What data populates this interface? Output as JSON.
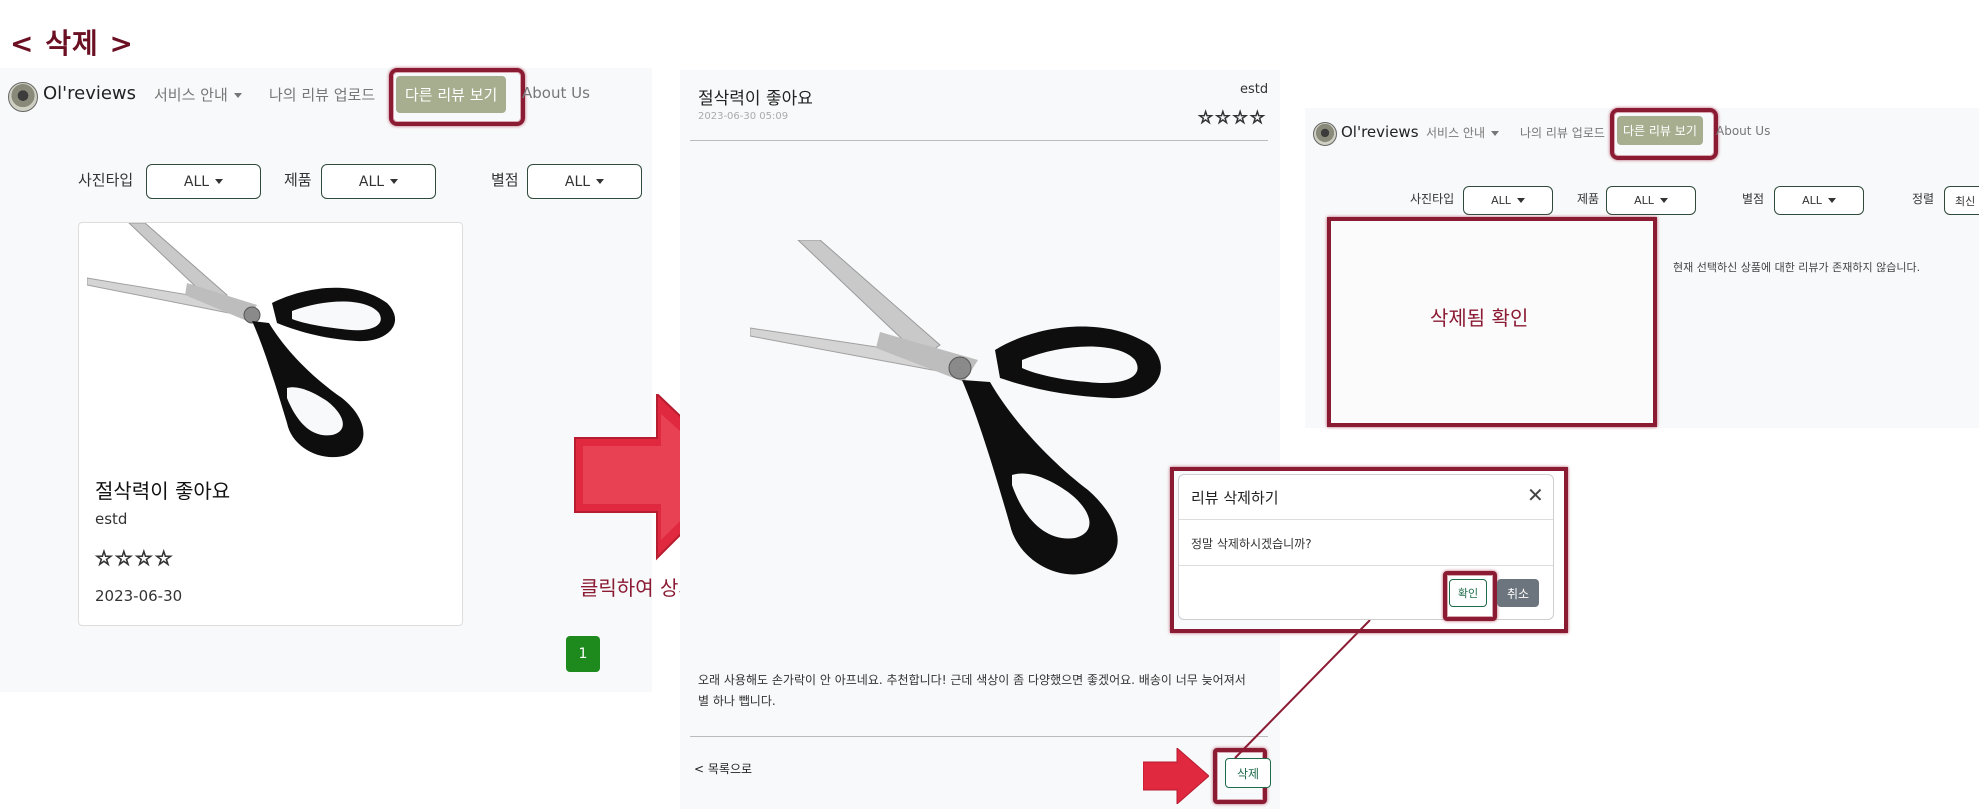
{
  "page": {
    "title": "< 삭제 >"
  },
  "navbar": {
    "brand": "Ol'reviews",
    "service_info": "서비스 안내",
    "my_review_upload": "나의 리뷰 업로드",
    "other_reviews": "다른 리뷰 보기",
    "about_us": "About Us"
  },
  "filters": {
    "photo_type_label": "사진타입",
    "product_label": "제품",
    "rating_label": "별점",
    "sort_label": "정렬",
    "all_value": "ALL",
    "sort_value_partial": "최신"
  },
  "list_panel": {
    "card": {
      "title": "절삭력이 좋아요",
      "author": "estd",
      "stars": "☆☆☆☆",
      "rating": 4,
      "date": "2023-06-30"
    },
    "pagination": {
      "current_page": "1"
    }
  },
  "arrow_annotation": {
    "text": "클릭하여 상세보기"
  },
  "detail_panel": {
    "title": "절삭력이 좋아요",
    "author": "estd",
    "datetime": "2023-06-30 05:09",
    "stars": "☆☆☆☆",
    "rating": 4,
    "body": "오래 사용해도 손가락이 안 아프네요. 추천합니다! 근데 색상이 좀 다양했으면 좋겠어요. 배송이 너무 늦어져서 별 하나 뺍니다.",
    "back_link": "< 목록으로",
    "delete_button": "삭제"
  },
  "modal": {
    "title": "리뷰 삭제하기",
    "message": "정말 삭제하시겠습니까?",
    "confirm_button": "확인",
    "cancel_button": "취소"
  },
  "result_panel": {
    "empty_message": "현재 선택하신 상품에 대한 리뷰가 존재하지 않습니다.",
    "annotation": "삭제됨 확인"
  },
  "colors": {
    "accent_nav": "#a6ae8f",
    "highlight": "#8b1a33",
    "page_btn": "#1e8a1e",
    "title": "#6b0f22"
  }
}
